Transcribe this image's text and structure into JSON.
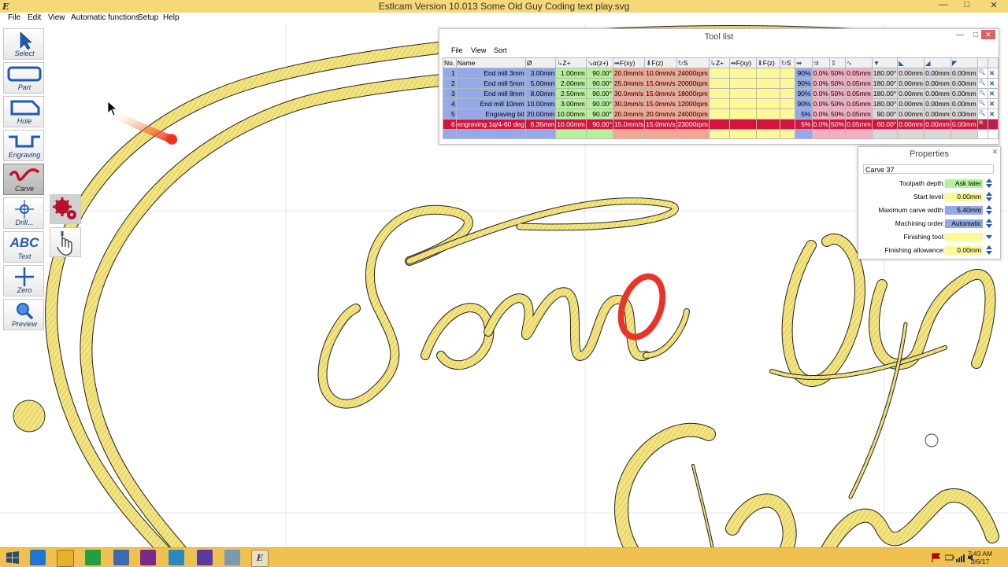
{
  "window": {
    "title": "Estlcam Version 10.013 Some Old Guy Coding text play.svg",
    "app_icon": "E",
    "minimize": "—",
    "maximize": "□",
    "close": "✕"
  },
  "menubar": [
    "File",
    "Edit",
    "View",
    "Automatic functions",
    "Setup",
    "Help"
  ],
  "toolbar": [
    {
      "label": "Select",
      "icon": "arrow-icon"
    },
    {
      "label": "Part",
      "icon": "part-icon"
    },
    {
      "label": "Hole",
      "icon": "hole-icon"
    },
    {
      "label": "Engraving",
      "icon": "engraving-icon"
    },
    {
      "label": "Carve",
      "icon": "carve-icon",
      "active": true
    },
    {
      "label": "Drill...",
      "icon": "drill-icon"
    },
    {
      "label": "Text",
      "icon": "text-icon",
      "text": "ABC"
    },
    {
      "label": "Zero",
      "icon": "zero-icon"
    },
    {
      "label": "Preview",
      "icon": "magnifier-icon"
    }
  ],
  "colors": {
    "title_bg": "#f5d878",
    "path": "#f2e27a",
    "path_stroke": "#111111",
    "selected_row": "#d4143c",
    "highlight": "#e8352a",
    "taskbar": "#f0c050"
  },
  "tool_list": {
    "title": "Tool list",
    "menu": [
      "File",
      "View",
      "Sort"
    ],
    "headers": [
      "No.",
      "Name",
      "Ø",
      "Z+",
      "α(z+)",
      "F(xy)",
      "F(z)",
      "S",
      "Z+",
      "F(xy)",
      "F(z)",
      "S",
      "",
      "",
      "",
      "",
      "",
      "",
      "",
      ""
    ],
    "rows": [
      {
        "no": "1",
        "name": "End mill 3mm",
        "d": "3.00mm",
        "z": "1.00mm",
        "a": "90.00°",
        "fxy": "20.0mm/s",
        "fz": "10.0mm/s",
        "s": "24000rpm",
        "p1": "90%",
        "p2": "0.0%",
        "p3": "50%",
        "p4": "0.05mm",
        "ang": "180.00°",
        "m1": "0.00mm",
        "m2": "0.00mm",
        "m3": "0.00mm"
      },
      {
        "no": "2",
        "name": "End mill 5mm",
        "d": "5.00mm",
        "z": "2.00mm",
        "a": "90.00°",
        "fxy": "25.0mm/s",
        "fz": "15.0mm/s",
        "s": "20000rpm",
        "p1": "90%",
        "p2": "0.0%",
        "p3": "50%",
        "p4": "0.05mm",
        "ang": "180.00°",
        "m1": "0.00mm",
        "m2": "0.00mm",
        "m3": "0.00mm"
      },
      {
        "no": "3",
        "name": "End mill 8mm",
        "d": "8.00mm",
        "z": "2.50mm",
        "a": "90.00°",
        "fxy": "30.0mm/s",
        "fz": "15.0mm/s",
        "s": "18000rpm",
        "p1": "90%",
        "p2": "0.0%",
        "p3": "50%",
        "p4": "0.05mm",
        "ang": "180.00°",
        "m1": "0.00mm",
        "m2": "0.00mm",
        "m3": "0.00mm"
      },
      {
        "no": "4",
        "name": "End mill 10mm",
        "d": "10.00mm",
        "z": "3.00mm",
        "a": "90.00°",
        "fxy": "30.0mm/s",
        "fz": "15.0mm/s",
        "s": "12000rpm",
        "p1": "90%",
        "p2": "0.0%",
        "p3": "50%",
        "p4": "0.05mm",
        "ang": "180.00°",
        "m1": "0.00mm",
        "m2": "0.00mm",
        "m3": "0.00mm"
      },
      {
        "no": "5",
        "name": "Engraving bit",
        "d": "20.00mm",
        "z": "10.00mm",
        "a": "90.00°",
        "fxy": "20.0mm/s",
        "fz": "20.0mm/s",
        "s": "24000rpm",
        "p1": "5%",
        "p2": "0.0%",
        "p3": "50%",
        "p4": "0.05mm",
        "ang": "90.00°",
        "m1": "0.00mm",
        "m2": "0.00mm",
        "m3": "0.00mm"
      },
      {
        "no": "6",
        "name": "engraving 1q/4-60 deg",
        "d": "6.35mm",
        "z": "10.00mm",
        "a": "90.00°",
        "fxy": "15.0mm/s",
        "fz": "15.0mm/s",
        "s": "23000rpm",
        "p1": "5%",
        "p2": "0.0%",
        "p3": "50%",
        "p4": "0.05mm",
        "ang": "60.00°",
        "m1": "0.00mm",
        "m2": "0.00mm",
        "m3": "0.00mm",
        "selected": true
      }
    ]
  },
  "properties": {
    "title": "Properties",
    "name": "Carve 37",
    "fields": [
      {
        "label": "Toolpath depth:",
        "value": "Ask later",
        "color": "#b6f09a"
      },
      {
        "label": "Start level:",
        "value": "0.00mm",
        "color": "#fdf89a"
      },
      {
        "label": "Maximum carve width:",
        "value": "5.40mm",
        "color": "#94aae8"
      },
      {
        "label": "Machining order:",
        "value": "Automatic",
        "color": "#94aae8"
      },
      {
        "label": "Finishing tool:",
        "value": "",
        "color": "#fdf89a"
      },
      {
        "label": "Finishing allowance:",
        "value": "0.00mm",
        "color": "#fdf89a"
      }
    ]
  },
  "canvas_text": "Some Old Guy Coding",
  "taskbar": {
    "time": "7:43 AM",
    "date": "3/6/17"
  }
}
